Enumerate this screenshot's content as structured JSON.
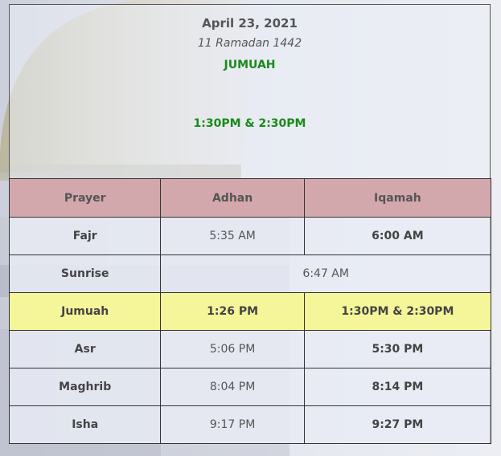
{
  "header": {
    "date": "April 23, 2021",
    "hijri": "11 Ramadan 1442",
    "jumuah_label": "JUMUAH",
    "jumuah_times": "1:30PM & 2:30PM"
  },
  "table": {
    "headers": {
      "prayer": "Prayer",
      "adhan": "Adhan",
      "iqamah": "Iqamah"
    },
    "rows": [
      {
        "prayer": "Fajr",
        "adhan": "5:35 AM",
        "iqamah": "6:00 AM"
      },
      {
        "prayer": "Sunrise",
        "combined": "6:47 AM"
      },
      {
        "prayer": "Jumuah",
        "adhan": "1:26 PM",
        "iqamah": "1:30PM & 2:30PM"
      },
      {
        "prayer": "Asr",
        "adhan": "5:06 PM",
        "iqamah": "5:30 PM"
      },
      {
        "prayer": "Maghrib",
        "adhan": "8:04 PM",
        "iqamah": "8:14 PM"
      },
      {
        "prayer": "Isha",
        "adhan": "9:17 PM",
        "iqamah": "9:27 PM"
      }
    ]
  },
  "colors": {
    "header_row": "#d3a8ac",
    "highlight_row": "#f5f59a",
    "jumuah_text": "#1a8a1a"
  }
}
